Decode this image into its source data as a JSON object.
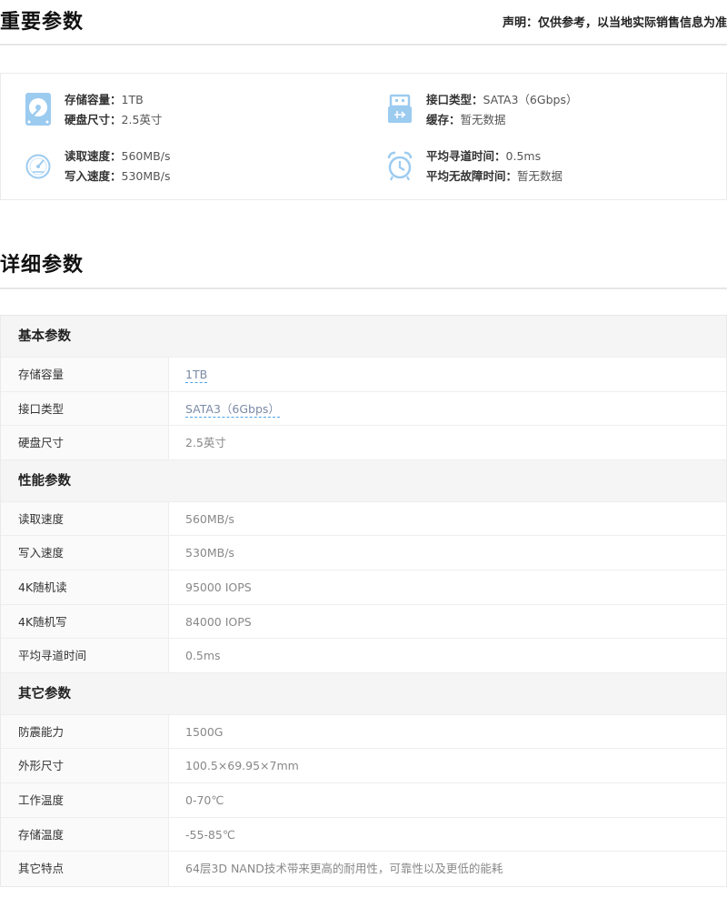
{
  "important": {
    "title": "重要参数",
    "disclaimer": "声明：仅供参考，以当地实际销售信息为准",
    "items": [
      {
        "icon": "hard-disk-icon",
        "lines": [
          {
            "k": "存储容量：",
            "v": "1TB"
          },
          {
            "k": "硬盘尺寸：",
            "v": "2.5英寸"
          }
        ]
      },
      {
        "icon": "usb-interface-icon",
        "lines": [
          {
            "k": "接口类型：",
            "v": "SATA3（6Gbps）"
          },
          {
            "k": "缓存：",
            "v": "暂无数据"
          }
        ]
      },
      {
        "icon": "speedometer-icon",
        "lines": [
          {
            "k": "读取速度：",
            "v": "560MB/s"
          },
          {
            "k": "写入速度：",
            "v": "530MB/s"
          }
        ]
      },
      {
        "icon": "alarm-clock-icon",
        "lines": [
          {
            "k": "平均寻道时间：",
            "v": "0.5ms"
          },
          {
            "k": "平均无故障时间：",
            "v": "暂无数据"
          }
        ]
      }
    ]
  },
  "detail": {
    "title": "详细参数",
    "groups": [
      {
        "name": "基本参数",
        "rows": [
          {
            "k": "存储容量",
            "v": "1TB",
            "link": true
          },
          {
            "k": "接口类型",
            "v": "SATA3（6Gbps）",
            "link": true
          },
          {
            "k": "硬盘尺寸",
            "v": "2.5英寸"
          }
        ]
      },
      {
        "name": "性能参数",
        "rows": [
          {
            "k": "读取速度",
            "v": "560MB/s"
          },
          {
            "k": "写入速度",
            "v": "530MB/s"
          },
          {
            "k": "4K随机读",
            "v": "95000 IOPS"
          },
          {
            "k": "4K随机写",
            "v": "84000 IOPS"
          },
          {
            "k": "平均寻道时间",
            "v": "0.5ms"
          }
        ]
      },
      {
        "name": "其它参数",
        "rows": [
          {
            "k": "防震能力",
            "v": "1500G"
          },
          {
            "k": "外形尺寸",
            "v": "100.5×69.95×7mm"
          },
          {
            "k": "工作温度",
            "v": "0-70℃"
          },
          {
            "k": "存储温度",
            "v": "-55-85℃"
          },
          {
            "k": "其它特点",
            "v": "64层3D NAND技术带来更高的耐用性，可靠性以及更低的能耗"
          }
        ]
      }
    ]
  },
  "colors": {
    "icon_blue": "#8fc4ef",
    "link_underline": "#4aa3e8"
  }
}
